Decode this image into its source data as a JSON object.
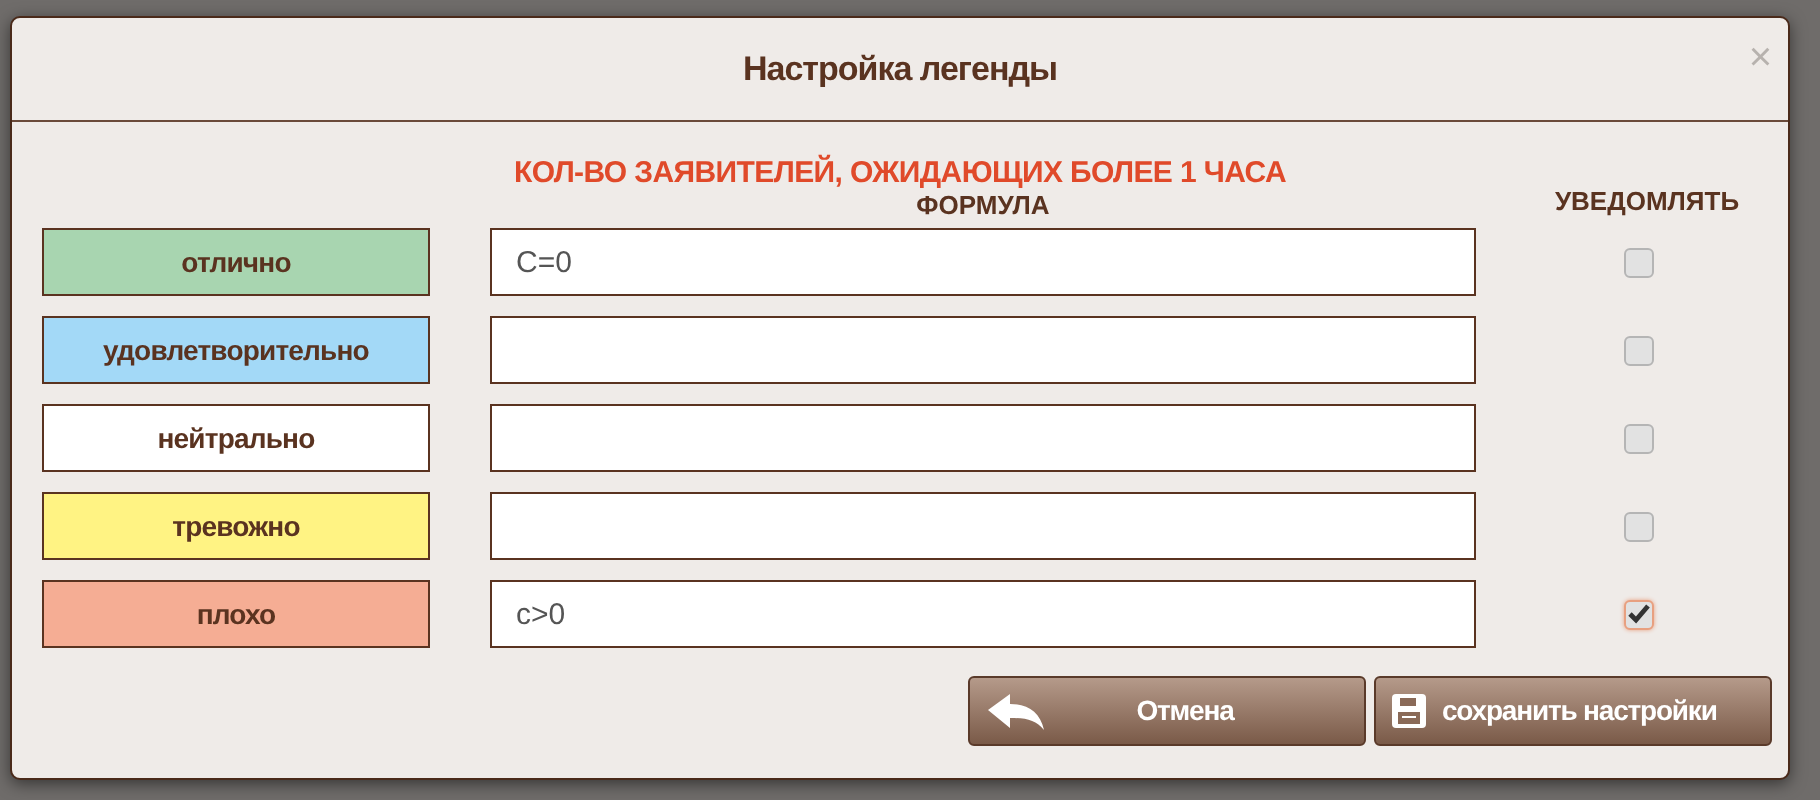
{
  "dialog": {
    "title": "Настройка легенды",
    "close": "×"
  },
  "subtitle": "КОЛ-ВО ЗАЯВИТЕЛЕЙ, ОЖИДАЮЩИХ БОЛЕЕ 1 ЧАСА",
  "columns": {
    "formula": "ФОРМУЛА",
    "notify": "УВЕДОМЛЯТЬ"
  },
  "levels": [
    {
      "label": "отлично",
      "color": "#a8d5b0",
      "formula": "C=0",
      "notify": false
    },
    {
      "label": "удовлетворительно",
      "color": "#a3d9f7",
      "notify": false
    },
    {
      "label": "нейтрально",
      "color": "#ffffff",
      "notify": false
    },
    {
      "label": "тревожно",
      "color": "#fff383",
      "notify": false
    },
    {
      "label": "плохо",
      "color": "#f5ad94",
      "formula": "c>0",
      "notify": true
    }
  ],
  "buttons": [
    {
      "kind": "cancel",
      "label": "Отмена"
    },
    {
      "kind": "save",
      "label": "сохранить настройки"
    }
  ]
}
